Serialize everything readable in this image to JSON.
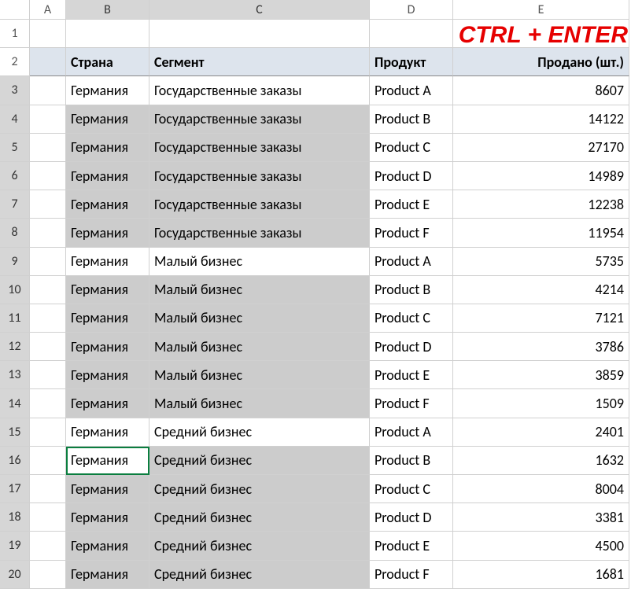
{
  "annotation": "CTRL + ENTER",
  "columns": [
    "A",
    "B",
    "C",
    "D",
    "E"
  ],
  "row_labels": [
    "1",
    "2",
    "3",
    "4",
    "5",
    "6",
    "7",
    "8",
    "9",
    "10",
    "11",
    "12",
    "13",
    "14",
    "15",
    "16",
    "17",
    "18",
    "19",
    "20"
  ],
  "header": {
    "country": "Страна",
    "segment": "Сегмент",
    "product": "Продукт",
    "sold": "Продано (шт.)"
  },
  "rows": [
    {
      "country": "Германия",
      "segment": "Государственные заказы",
      "product": "Product A",
      "sold": "8607"
    },
    {
      "country": "Германия",
      "segment": "Государственные заказы",
      "product": "Product B",
      "sold": "14122"
    },
    {
      "country": "Германия",
      "segment": "Государственные заказы",
      "product": "Product C",
      "sold": "27170"
    },
    {
      "country": "Германия",
      "segment": "Государственные заказы",
      "product": "Product D",
      "sold": "14989"
    },
    {
      "country": "Германия",
      "segment": "Государственные заказы",
      "product": "Product E",
      "sold": "12238"
    },
    {
      "country": "Германия",
      "segment": "Государственные заказы",
      "product": "Product F",
      "sold": "11954"
    },
    {
      "country": "Германия",
      "segment": "Малый бизнес",
      "product": "Product A",
      "sold": "5735"
    },
    {
      "country": "Германия",
      "segment": "Малый бизнес",
      "product": "Product B",
      "sold": "4214"
    },
    {
      "country": "Германия",
      "segment": "Малый бизнес",
      "product": "Product C",
      "sold": "7121"
    },
    {
      "country": "Германия",
      "segment": "Малый бизнес",
      "product": "Product D",
      "sold": "3786"
    },
    {
      "country": "Германия",
      "segment": "Малый бизнес",
      "product": "Product E",
      "sold": "3859"
    },
    {
      "country": "Германия",
      "segment": "Малый бизнес",
      "product": "Product F",
      "sold": "1509"
    },
    {
      "country": "Германия",
      "segment": "Средний бизнес",
      "product": "Product A",
      "sold": "2401"
    },
    {
      "country": "Германия",
      "segment": "Средний бизнес",
      "product": "Product B",
      "sold": "1632"
    },
    {
      "country": "Германия",
      "segment": "Средний бизнес",
      "product": "Product C",
      "sold": "8004"
    },
    {
      "country": "Германия",
      "segment": "Средний бизнес",
      "product": "Product D",
      "sold": "3381"
    },
    {
      "country": "Германия",
      "segment": "Средний бизнес",
      "product": "Product E",
      "sold": "4500"
    },
    {
      "country": "Германия",
      "segment": "Средний бизнес",
      "product": "Product F",
      "sold": "1681"
    }
  ],
  "selection": {
    "active_cell": {
      "row": 16,
      "col": "B"
    },
    "selected_bc_rows": [
      4,
      5,
      6,
      7,
      8,
      10,
      11,
      12,
      13,
      14,
      16,
      17,
      18,
      19,
      20
    ],
    "nonselected_bc_rows": [
      3,
      9,
      15
    ]
  }
}
